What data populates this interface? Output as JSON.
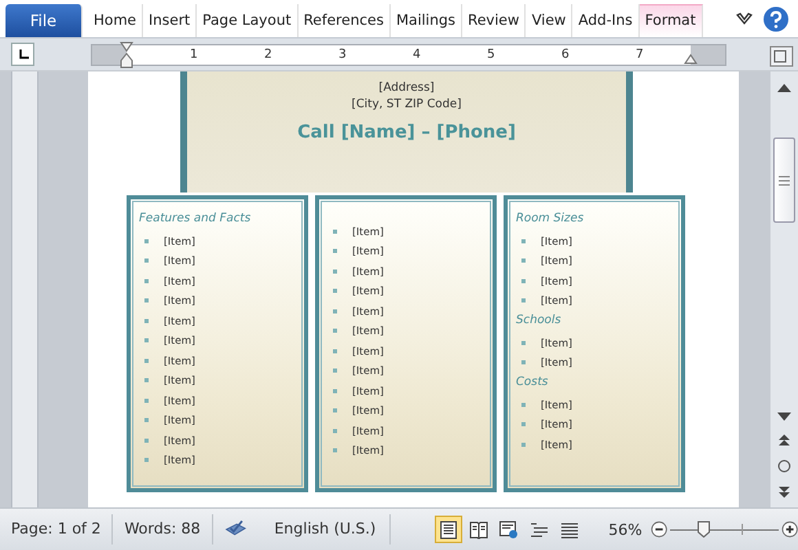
{
  "ribbon": {
    "tabs": [
      {
        "label": "File",
        "kind": "file",
        "selected": false
      },
      {
        "label": "Home",
        "kind": "tab",
        "selected": false
      },
      {
        "label": "Insert",
        "kind": "tab",
        "selected": false
      },
      {
        "label": "Page Layout",
        "kind": "tab",
        "selected": false
      },
      {
        "label": "References",
        "kind": "tab",
        "selected": false
      },
      {
        "label": "Mailings",
        "kind": "tab",
        "selected": false
      },
      {
        "label": "Review",
        "kind": "tab",
        "selected": false
      },
      {
        "label": "View",
        "kind": "tab",
        "selected": false
      },
      {
        "label": "Add-Ins",
        "kind": "tab",
        "selected": false
      },
      {
        "label": "Format",
        "kind": "contextual",
        "selected": false
      }
    ]
  },
  "ruler": {
    "numbers": [
      "1",
      "2",
      "3",
      "4",
      "5",
      "6",
      "7"
    ]
  },
  "document": {
    "address": "[Address]",
    "city": "[City, ST  ZIP Code]",
    "call": "Call [Name] – [Phone]",
    "columns": [
      {
        "sections": [
          {
            "heading": "Features and Facts",
            "items": [
              "[Item]",
              "[Item]",
              "[Item]",
              "[Item]",
              "[Item]",
              "[Item]",
              "[Item]",
              "[Item]",
              "[Item]",
              "[Item]",
              "[Item]",
              "[Item]"
            ]
          }
        ]
      },
      {
        "sections": [
          {
            "items": [
              "[Item]",
              "[Item]",
              "[Item]",
              "[Item]",
              "[Item]",
              "[Item]",
              "[Item]",
              "[Item]",
              "[Item]",
              "[Item]",
              "[Item]",
              "[Item]"
            ]
          }
        ]
      },
      {
        "sections": [
          {
            "heading": "Room Sizes",
            "items": [
              "[Item]",
              "[Item]",
              "[Item]",
              "[Item]"
            ]
          },
          {
            "heading": "Schools",
            "items": [
              "[Item]",
              "[Item]"
            ]
          },
          {
            "heading": "Costs",
            "items": [
              "[Item]",
              "[Item]",
              "[Item]"
            ]
          }
        ]
      }
    ]
  },
  "status_bar": {
    "page": "Page: 1 of 2",
    "words": "Words: 88",
    "language": "English (U.S.)",
    "views": [
      {
        "kind": "print",
        "selected": true
      },
      {
        "kind": "reading",
        "selected": false
      },
      {
        "kind": "web",
        "selected": false
      },
      {
        "kind": "outline",
        "selected": false
      },
      {
        "kind": "draft",
        "selected": false
      }
    ],
    "zoom": "56%",
    "zoom_slider": {
      "level": 0.3
    }
  }
}
